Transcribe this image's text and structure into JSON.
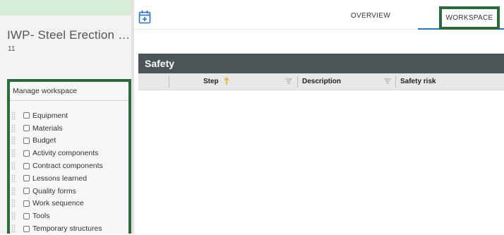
{
  "left_panel": {
    "title": "IWP- Steel Erection M...",
    "subtitle_number": "11"
  },
  "manage_workspace": {
    "heading": "Manage workspace",
    "items": [
      {
        "label": "Equipment",
        "checked": false
      },
      {
        "label": "Materials",
        "checked": false
      },
      {
        "label": "Budget",
        "checked": false
      },
      {
        "label": "Activity components",
        "checked": false
      },
      {
        "label": "Contract components",
        "checked": false
      },
      {
        "label": "Lessons learned",
        "checked": false
      },
      {
        "label": "Quality forms",
        "checked": false
      },
      {
        "label": "Work sequence",
        "checked": false
      },
      {
        "label": "Tools",
        "checked": false
      },
      {
        "label": "Temporary structures",
        "checked": false
      }
    ]
  },
  "nav": {
    "icon": "calendar-add-icon",
    "tabs": [
      {
        "label": "OVERVIEW",
        "active": false
      },
      {
        "label": "WORKSPACE",
        "active": true
      }
    ]
  },
  "safety": {
    "title": "Safety",
    "columns": [
      {
        "label": "Step",
        "sorted": "ascending"
      },
      {
        "label": "Description"
      },
      {
        "label": "Safety risk"
      }
    ]
  },
  "colors": {
    "highlight_border": "#2e6b3c",
    "header_bar": "#4b5557",
    "accent_blue": "#2a72c7",
    "sort_arrow": "#f5a623",
    "top_strip": "#d5eed5"
  }
}
